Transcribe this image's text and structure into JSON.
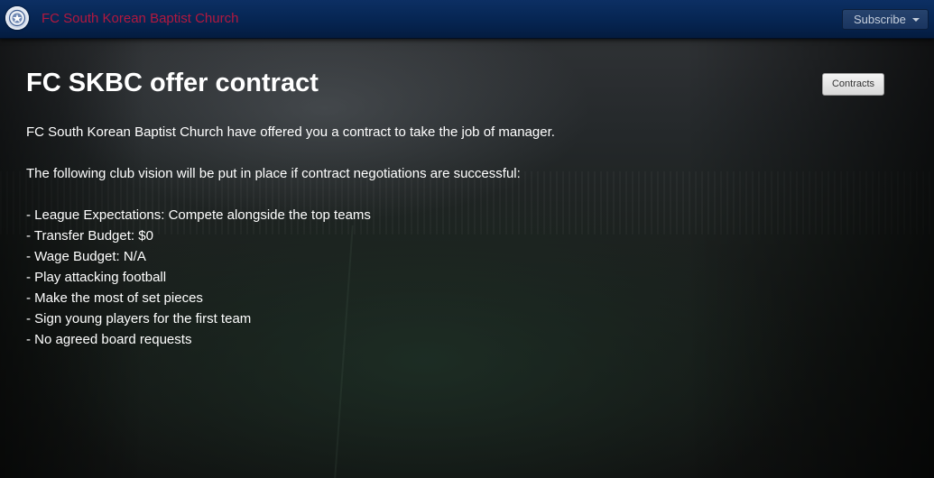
{
  "navbar": {
    "club_name": "FC South Korean Baptist Church",
    "subscribe_label": "Subscribe",
    "logo_icon": "club-crest-icon",
    "title_color": "#b3183f",
    "bar_color": "#062552"
  },
  "main": {
    "title": "FC SKBC offer contract",
    "contracts_button": "Contracts",
    "intro": "FC South Korean Baptist Church have offered you a contract to take the job of manager.",
    "vision_intro": "The following club vision will be put in place if contract negotiations are successful:",
    "vision_items": [
      "- League Expectations: Compete alongside the top teams",
      "- Transfer Budget: $0",
      "- Wage Budget: N/A",
      "- Play attacking football",
      "- Make the most of set pieces",
      "- Sign young players for the first team",
      "- No agreed board requests"
    ]
  }
}
